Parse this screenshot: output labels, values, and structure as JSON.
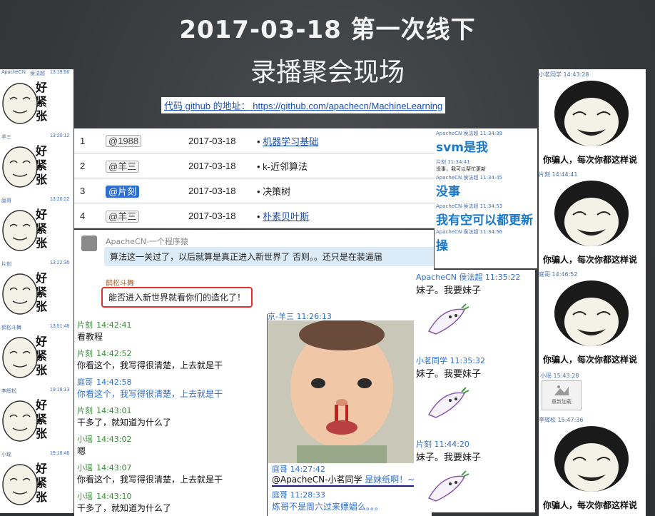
{
  "title_line1": "2017-03-18 第一次线下",
  "title_line2": "录播聚会现场",
  "github_label": "代码 github 的地址：",
  "github_url": "https://github.com/apachecn/MachineLearning",
  "left_column": [
    {
      "name": "ApacheCN",
      "user": "侯法超",
      "time": "13:19:56",
      "text": "好紧张"
    },
    {
      "name": "羊三",
      "time": "13:20:12",
      "text": "好紧张"
    },
    {
      "name": "庭哥",
      "time": "13:20:22",
      "text": "好紧张"
    },
    {
      "name": "片刻",
      "time": "13:22:36",
      "text": "好紧张"
    },
    {
      "name": "鹤松斗舞",
      "time": "13:51:48",
      "text": "好紧张"
    },
    {
      "name": "李辉松",
      "time": "19:18:13",
      "text": "好紧张"
    },
    {
      "name": "小瑶",
      "time": "19:18:46",
      "text": "好紧张"
    }
  ],
  "tasks": [
    {
      "idx": "1",
      "who": "@1988",
      "date": "2017-03-18",
      "topic": "机器学习基础",
      "link": true,
      "active": false
    },
    {
      "idx": "2",
      "who": "@羊三",
      "date": "2017-03-18",
      "topic": "k-近邻算法",
      "link": false,
      "active": false
    },
    {
      "idx": "3",
      "who": "@片刻",
      "date": "2017-03-18",
      "topic": "决策树",
      "link": false,
      "active": true
    },
    {
      "idx": "4",
      "who": "@羊三",
      "date": "2017-03-18",
      "topic": "朴素贝叶斯",
      "link": true,
      "active": false
    }
  ],
  "center_top": {
    "sender": "ApacheCN-一个程序猿",
    "bubble": "算法这一关过了，以后就算是真正进入新世界了      否则。。还只是在装逼届",
    "sender2": "鹤松斗舞",
    "bubble2": "能否进入新世界就看你们的造化了！"
  },
  "chat": [
    {
      "name": "片刻",
      "time": "14:42:41",
      "msg": "看教程",
      "blue": false
    },
    {
      "name": "片刻",
      "time": "14:42:52",
      "msg": "你看这个，我写得很清楚，上去就是干",
      "blue": false
    },
    {
      "name": "庭哥",
      "time": "14:42:58",
      "msg": "你看这个，我写得很清楚，上去就是干",
      "blue": true
    },
    {
      "name": "片刻",
      "time": "14:43:01",
      "msg": "干多了，就知道为什么了",
      "blue": false
    },
    {
      "name": "小瑶",
      "time": "14:43:02",
      "msg": "嗯",
      "blue": false
    },
    {
      "name": "小瑶",
      "time": "14:43:07",
      "msg": "你看这个，我写得很清楚，上去就是干",
      "blue": false
    },
    {
      "name": "小瑶",
      "time": "14:43:10",
      "msg": "干多了，就知道为什么了",
      "blue": false
    }
  ],
  "baby": {
    "header": "京-羊三  11:26:13",
    "r1_name": "庭哥  14:27:42",
    "r1_msg": "@ApacheCN-小茗同学",
    "r1_link": "是妹纸啊！~",
    "r2_name": "庭哥  11:28:33",
    "r2_msg": "炼哥不是周六过来嫖娼么。。。"
  },
  "right_mid": [
    {
      "name": "ApacheCN 侯法超 11:34:39",
      "big": "svm是我"
    },
    {
      "name": "片刻 11:34:41",
      "small": "没事，我可以帮忙更新"
    },
    {
      "name": "ApacheCN 侯法超 11:34:45",
      "big": "没事"
    },
    {
      "name": "ApacheCN 侯法超 11:34:53",
      "big": "我有空可以都更新"
    },
    {
      "name": "ApacheCN 侯法超 11:34:56",
      "big": "操"
    }
  ],
  "sister": [
    {
      "name": "ApacheCN  侯法超  11:35:22",
      "msg": "妹子。我要妹子"
    },
    {
      "name": "小茗同学  11:35:32",
      "msg": "妹子。我要妹子"
    },
    {
      "name": "片刻  11:44:20",
      "msg": "妹子。我要妹子"
    }
  ],
  "far_right": [
    {
      "name": "小茗同学  14:43:28",
      "caption": "你骗人，每次你都这样说"
    },
    {
      "name": "片刻  14:44:41",
      "caption": "你骗人，每次你都这样说"
    },
    {
      "name": "庭哥  14:46:52",
      "caption": "你骗人，每次你都这样说"
    },
    {
      "name": "李辉松  15:47:36",
      "caption": "你骗人，每次你都这样说"
    }
  ],
  "reload": {
    "name": "小瑶  15:43:28",
    "label": "重新加载"
  },
  "colors": {
    "board": "#3a3d40",
    "link": "#1a4fb4",
    "chat_green": "#3c8c3c",
    "chat_blue": "#2f6fd0",
    "alert_red": "#e03030"
  }
}
